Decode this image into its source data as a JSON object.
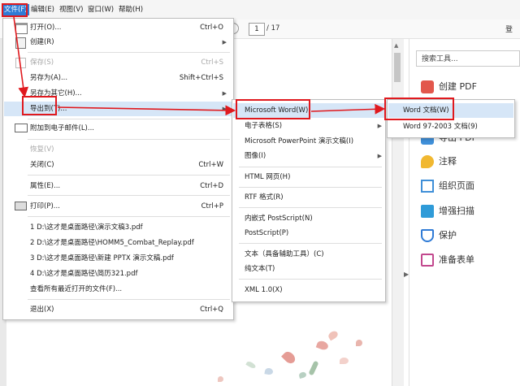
{
  "menubar": {
    "items": [
      "文件(F)",
      "编辑(E)",
      "视图(V)",
      "窗口(W)",
      "帮助(H)"
    ]
  },
  "toolbar": {
    "page_current": "1",
    "page_total": "/ 17",
    "right_text": "登"
  },
  "file_menu": {
    "open": {
      "label": "打开(O)...",
      "shortcut": "Ctrl+O"
    },
    "create": {
      "label": "创建(R)"
    },
    "save": {
      "label": "保存(S)",
      "shortcut": "Ctrl+S"
    },
    "save_as": {
      "label": "另存为(A)...",
      "shortcut": "Shift+Ctrl+S"
    },
    "save_as_other": {
      "label": "另存为其它(H)..."
    },
    "export_to": {
      "label": "导出到(T)..."
    },
    "attach_email": {
      "label": "附加到电子邮件(L)..."
    },
    "revert": {
      "label": "恢复(V)"
    },
    "close": {
      "label": "关闭(C)",
      "shortcut": "Ctrl+W"
    },
    "properties": {
      "label": "属性(E)...",
      "shortcut": "Ctrl+D"
    },
    "print": {
      "label": "打印(P)...",
      "shortcut": "Ctrl+P"
    },
    "recent": [
      "1 D:\\这才是桌面路径\\演示文稿3.pdf",
      "2 D:\\这才是桌面路径\\HOMM5_Combat_Replay.pdf",
      "3 D:\\这才是桌面路径\\新建 PPTX 演示文稿.pdf",
      "4 D:\\这才是桌面路径\\简历321.pdf"
    ],
    "view_all_recent": "查看所有最近打开的文件(F)...",
    "exit": {
      "label": "退出(X)",
      "shortcut": "Ctrl+Q"
    }
  },
  "export_menu": {
    "word": "Microsoft Word(W)",
    "spreadsheet": "电子表格(S)",
    "powerpoint": "Microsoft PowerPoint 演示文稿(I)",
    "image": "图像(I)",
    "html": "HTML 网页(H)",
    "rtf": "RTF 格式(R)",
    "embedded_ps": "内嵌式 PostScript(N)",
    "postscript": "PostScript(P)",
    "accessible_text": "文本（具备辅助工具）(C)",
    "plain_text": "纯文本(T)",
    "xml": "XML 1.0(X)"
  },
  "word_submenu": {
    "word_doc": "Word 文档(W)",
    "word_97": "Word 97-2003 文档(9)"
  },
  "right_panel": {
    "search_placeholder": "搜索工具...",
    "tools": [
      "创建 PDF",
      "导出 PDF",
      "注释",
      "组织页面",
      "增强扫描",
      "保护",
      "准备表单"
    ]
  },
  "colors": {
    "highlight_box": "#e0191e",
    "menu_hover": "#d6e6f7",
    "active_menu": "#2f7bd6"
  }
}
